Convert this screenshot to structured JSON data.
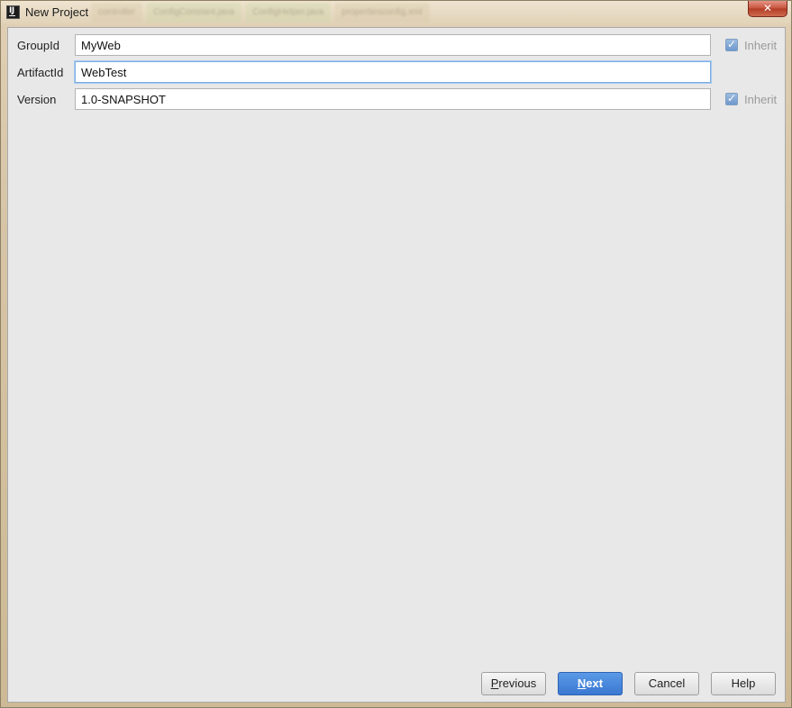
{
  "window": {
    "title": "New Project"
  },
  "background_tabs": [
    "controller",
    "ConfigConstant.java",
    "ConfigHelper.java",
    "propertiesconfig.xml"
  ],
  "form": {
    "fields": [
      {
        "label": "GroupId",
        "value": "MyWeb",
        "inherit": {
          "label": "Inherit",
          "checked": true,
          "enabled": false
        }
      },
      {
        "label": "ArtifactId",
        "value": "WebTest",
        "focused": true
      },
      {
        "label": "Version",
        "value": "1.0-SNAPSHOT",
        "inherit": {
          "label": "Inherit",
          "checked": true,
          "enabled": false
        }
      }
    ]
  },
  "buttons": {
    "previous": {
      "mnemonic": "P",
      "rest": "revious"
    },
    "next": {
      "mnemonic": "N",
      "rest": "ext"
    },
    "cancel": "Cancel",
    "help": "Help"
  },
  "colors": {
    "primary_button": "#3a78d2",
    "content_bg": "#e8e8e8",
    "focus_border": "#7eaee4"
  },
  "icons": {
    "app": "intellij-idea-icon",
    "close": "close-icon",
    "checkbox": "checkmark-icon"
  }
}
